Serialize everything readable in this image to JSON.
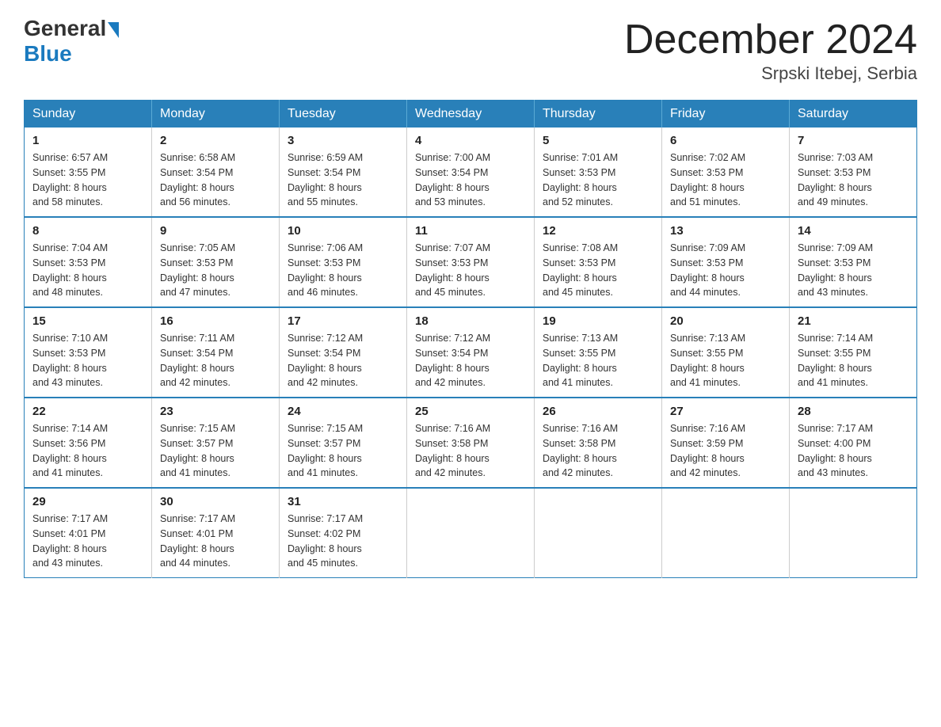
{
  "header": {
    "logo_general": "General",
    "logo_blue": "Blue",
    "title": "December 2024",
    "subtitle": "Srpski Itebej, Serbia"
  },
  "days_of_week": [
    "Sunday",
    "Monday",
    "Tuesday",
    "Wednesday",
    "Thursday",
    "Friday",
    "Saturday"
  ],
  "weeks": [
    [
      {
        "day": "1",
        "info": "Sunrise: 6:57 AM\nSunset: 3:55 PM\nDaylight: 8 hours\nand 58 minutes."
      },
      {
        "day": "2",
        "info": "Sunrise: 6:58 AM\nSunset: 3:54 PM\nDaylight: 8 hours\nand 56 minutes."
      },
      {
        "day": "3",
        "info": "Sunrise: 6:59 AM\nSunset: 3:54 PM\nDaylight: 8 hours\nand 55 minutes."
      },
      {
        "day": "4",
        "info": "Sunrise: 7:00 AM\nSunset: 3:54 PM\nDaylight: 8 hours\nand 53 minutes."
      },
      {
        "day": "5",
        "info": "Sunrise: 7:01 AM\nSunset: 3:53 PM\nDaylight: 8 hours\nand 52 minutes."
      },
      {
        "day": "6",
        "info": "Sunrise: 7:02 AM\nSunset: 3:53 PM\nDaylight: 8 hours\nand 51 minutes."
      },
      {
        "day": "7",
        "info": "Sunrise: 7:03 AM\nSunset: 3:53 PM\nDaylight: 8 hours\nand 49 minutes."
      }
    ],
    [
      {
        "day": "8",
        "info": "Sunrise: 7:04 AM\nSunset: 3:53 PM\nDaylight: 8 hours\nand 48 minutes."
      },
      {
        "day": "9",
        "info": "Sunrise: 7:05 AM\nSunset: 3:53 PM\nDaylight: 8 hours\nand 47 minutes."
      },
      {
        "day": "10",
        "info": "Sunrise: 7:06 AM\nSunset: 3:53 PM\nDaylight: 8 hours\nand 46 minutes."
      },
      {
        "day": "11",
        "info": "Sunrise: 7:07 AM\nSunset: 3:53 PM\nDaylight: 8 hours\nand 45 minutes."
      },
      {
        "day": "12",
        "info": "Sunrise: 7:08 AM\nSunset: 3:53 PM\nDaylight: 8 hours\nand 45 minutes."
      },
      {
        "day": "13",
        "info": "Sunrise: 7:09 AM\nSunset: 3:53 PM\nDaylight: 8 hours\nand 44 minutes."
      },
      {
        "day": "14",
        "info": "Sunrise: 7:09 AM\nSunset: 3:53 PM\nDaylight: 8 hours\nand 43 minutes."
      }
    ],
    [
      {
        "day": "15",
        "info": "Sunrise: 7:10 AM\nSunset: 3:53 PM\nDaylight: 8 hours\nand 43 minutes."
      },
      {
        "day": "16",
        "info": "Sunrise: 7:11 AM\nSunset: 3:54 PM\nDaylight: 8 hours\nand 42 minutes."
      },
      {
        "day": "17",
        "info": "Sunrise: 7:12 AM\nSunset: 3:54 PM\nDaylight: 8 hours\nand 42 minutes."
      },
      {
        "day": "18",
        "info": "Sunrise: 7:12 AM\nSunset: 3:54 PM\nDaylight: 8 hours\nand 42 minutes."
      },
      {
        "day": "19",
        "info": "Sunrise: 7:13 AM\nSunset: 3:55 PM\nDaylight: 8 hours\nand 41 minutes."
      },
      {
        "day": "20",
        "info": "Sunrise: 7:13 AM\nSunset: 3:55 PM\nDaylight: 8 hours\nand 41 minutes."
      },
      {
        "day": "21",
        "info": "Sunrise: 7:14 AM\nSunset: 3:55 PM\nDaylight: 8 hours\nand 41 minutes."
      }
    ],
    [
      {
        "day": "22",
        "info": "Sunrise: 7:14 AM\nSunset: 3:56 PM\nDaylight: 8 hours\nand 41 minutes."
      },
      {
        "day": "23",
        "info": "Sunrise: 7:15 AM\nSunset: 3:57 PM\nDaylight: 8 hours\nand 41 minutes."
      },
      {
        "day": "24",
        "info": "Sunrise: 7:15 AM\nSunset: 3:57 PM\nDaylight: 8 hours\nand 41 minutes."
      },
      {
        "day": "25",
        "info": "Sunrise: 7:16 AM\nSunset: 3:58 PM\nDaylight: 8 hours\nand 42 minutes."
      },
      {
        "day": "26",
        "info": "Sunrise: 7:16 AM\nSunset: 3:58 PM\nDaylight: 8 hours\nand 42 minutes."
      },
      {
        "day": "27",
        "info": "Sunrise: 7:16 AM\nSunset: 3:59 PM\nDaylight: 8 hours\nand 42 minutes."
      },
      {
        "day": "28",
        "info": "Sunrise: 7:17 AM\nSunset: 4:00 PM\nDaylight: 8 hours\nand 43 minutes."
      }
    ],
    [
      {
        "day": "29",
        "info": "Sunrise: 7:17 AM\nSunset: 4:01 PM\nDaylight: 8 hours\nand 43 minutes."
      },
      {
        "day": "30",
        "info": "Sunrise: 7:17 AM\nSunset: 4:01 PM\nDaylight: 8 hours\nand 44 minutes."
      },
      {
        "day": "31",
        "info": "Sunrise: 7:17 AM\nSunset: 4:02 PM\nDaylight: 8 hours\nand 45 minutes."
      },
      {
        "day": "",
        "info": ""
      },
      {
        "day": "",
        "info": ""
      },
      {
        "day": "",
        "info": ""
      },
      {
        "day": "",
        "info": ""
      }
    ]
  ]
}
